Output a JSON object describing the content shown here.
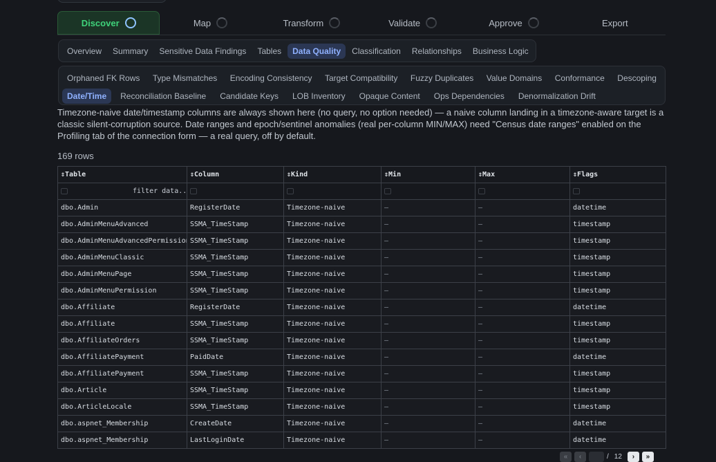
{
  "wizard": [
    {
      "label": "Discover",
      "active": true
    },
    {
      "label": "Map"
    },
    {
      "label": "Transform"
    },
    {
      "label": "Validate"
    },
    {
      "label": "Approve"
    },
    {
      "label": "Export"
    }
  ],
  "tabs1": [
    "Overview",
    "Summary",
    "Sensitive Data Findings",
    "Tables",
    "Data Quality",
    "Classification",
    "Relationships",
    "Business Logic"
  ],
  "tabs1_active": "Data Quality",
  "tabs2_row1": [
    "Orphaned FK Rows",
    "Type Mismatches",
    "Encoding Consistency",
    "Target Compatibility",
    "Fuzzy Duplicates",
    "Value Domains",
    "Conformance",
    "Descoping"
  ],
  "tabs2_row2": [
    "Date/Time",
    "Reconciliation Baseline",
    "Candidate Keys",
    "LOB Inventory",
    "Opaque Content",
    "Ops Dependencies",
    "Denormalization Drift"
  ],
  "tabs2_active": "Date/Time",
  "description": "Timezone-naive date/timestamp columns are always shown here (no query, no option needed) — a naive column landing in a timezone-aware target is a classic silent-corruption source. Date ranges and epoch/sentinel anomalies (real per-column MIN/MAX) need \"Census date ranges\" enabled on the Profiling tab of the connection form — a real query, off by default.",
  "row_count": "169 rows",
  "table": {
    "columns": [
      "Table",
      "Column",
      "Kind",
      "Min",
      "Max",
      "Flags"
    ],
    "sort_glyph": "⇕",
    "filter_placeholder": "filter data...",
    "rows": [
      [
        "dbo.Admin",
        "RegisterDate",
        "Timezone-naive",
        "—",
        "—",
        "datetime"
      ],
      [
        "dbo.AdminMenuAdvanced",
        "SSMA_TimeStamp",
        "Timezone-naive",
        "—",
        "—",
        "timestamp"
      ],
      [
        "dbo.AdminMenuAdvancedPermission",
        "SSMA_TimeStamp",
        "Timezone-naive",
        "—",
        "—",
        "timestamp"
      ],
      [
        "dbo.AdminMenuClassic",
        "SSMA_TimeStamp",
        "Timezone-naive",
        "—",
        "—",
        "timestamp"
      ],
      [
        "dbo.AdminMenuPage",
        "SSMA_TimeStamp",
        "Timezone-naive",
        "—",
        "—",
        "timestamp"
      ],
      [
        "dbo.AdminMenuPermission",
        "SSMA_TimeStamp",
        "Timezone-naive",
        "—",
        "—",
        "timestamp"
      ],
      [
        "dbo.Affiliate",
        "RegisterDate",
        "Timezone-naive",
        "—",
        "—",
        "datetime"
      ],
      [
        "dbo.Affiliate",
        "SSMA_TimeStamp",
        "Timezone-naive",
        "—",
        "—",
        "timestamp"
      ],
      [
        "dbo.AffiliateOrders",
        "SSMA_TimeStamp",
        "Timezone-naive",
        "—",
        "—",
        "timestamp"
      ],
      [
        "dbo.AffiliatePayment",
        "PaidDate",
        "Timezone-naive",
        "—",
        "—",
        "datetime"
      ],
      [
        "dbo.AffiliatePayment",
        "SSMA_TimeStamp",
        "Timezone-naive",
        "—",
        "—",
        "timestamp"
      ],
      [
        "dbo.Article",
        "SSMA_TimeStamp",
        "Timezone-naive",
        "—",
        "—",
        "timestamp"
      ],
      [
        "dbo.ArticleLocale",
        "SSMA_TimeStamp",
        "Timezone-naive",
        "—",
        "—",
        "timestamp"
      ],
      [
        "dbo.aspnet_Membership",
        "CreateDate",
        "Timezone-naive",
        "—",
        "—",
        "datetime"
      ],
      [
        "dbo.aspnet_Membership",
        "LastLoginDate",
        "Timezone-naive",
        "—",
        "—",
        "datetime"
      ]
    ]
  },
  "pager": {
    "first": "«",
    "prev": "‹",
    "separator": "/",
    "total_pages": "12",
    "next": "›",
    "last": "»"
  }
}
